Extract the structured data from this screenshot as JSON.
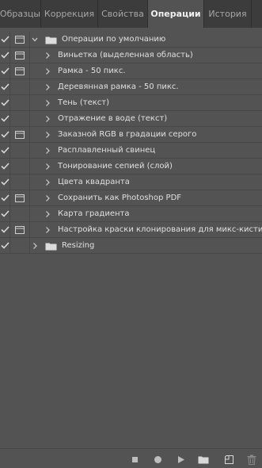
{
  "tabs": [
    {
      "label": "Образцы"
    },
    {
      "label": "Коррекция"
    },
    {
      "label": "Свойства"
    },
    {
      "label": "Операции",
      "active": true
    },
    {
      "label": "История"
    }
  ],
  "actions": {
    "set_name": "Операции по умолчанию",
    "items": [
      {
        "label": "Виньетка (выделенная область)",
        "dialog": true
      },
      {
        "label": "Рамка - 50 пикс.",
        "dialog": true
      },
      {
        "label": "Деревянная рамка - 50 пикс.",
        "dialog": false
      },
      {
        "label": "Тень (текст)",
        "dialog": false
      },
      {
        "label": "Отражение в воде (текст)",
        "dialog": false
      },
      {
        "label": "Заказной RGB в градации серого",
        "dialog": true
      },
      {
        "label": "Расплавленный свинец",
        "dialog": false
      },
      {
        "label": "Тонирование сепией (слой)",
        "dialog": false
      },
      {
        "label": "Цвета квадранта",
        "dialog": false
      },
      {
        "label": "Сохранить как Photoshop PDF",
        "dialog": true
      },
      {
        "label": "Карта градиента",
        "dialog": false
      },
      {
        "label": "Настройка краски клонирования для микс-кисти",
        "dialog": true
      }
    ],
    "second_set_name": "Resizing"
  },
  "colors": {
    "panel_bg": "#535353",
    "tab_bg": "#3c3c3c",
    "text": "#e0e0e0",
    "icon": "#d8d8d8"
  },
  "bottom_icons": [
    "stop-icon",
    "record-icon",
    "play-icon",
    "new-set-folder-icon",
    "new-action-icon",
    "trash-icon"
  ]
}
